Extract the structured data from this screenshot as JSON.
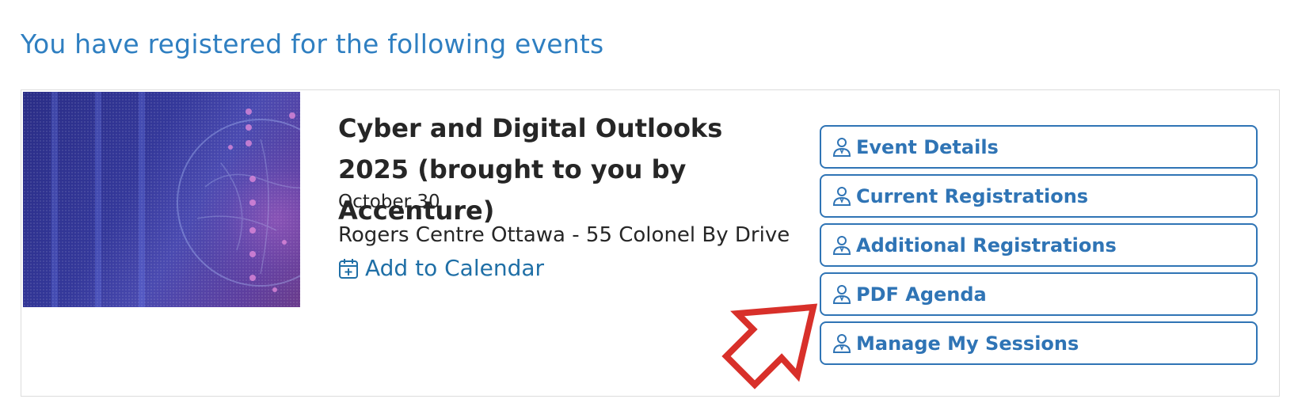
{
  "heading": "You have registered for the following events",
  "event": {
    "title": "Cyber and Digital Outlooks 2025 (brought to you by Accenture)",
    "date": "October 30",
    "venue": "Rogers Centre Ottawa - 55 Colonel By Drive",
    "add_to_calendar": "Add to Calendar",
    "calendar_icon": "calendar-plus-icon",
    "image_alt": "event-banner-image"
  },
  "actions": [
    {
      "label": "Event Details",
      "icon": "person-icon"
    },
    {
      "label": "Current Registrations",
      "icon": "person-icon"
    },
    {
      "label": "Additional Registrations",
      "icon": "person-icon"
    },
    {
      "label": "PDF Agenda",
      "icon": "person-icon"
    },
    {
      "label": "Manage My Sessions",
      "icon": "person-icon"
    }
  ],
  "colors": {
    "accent": "#2f74b5",
    "heading": "#2f7fc1",
    "link": "#1f6fa6",
    "annotation_arrow": "#d8302a"
  }
}
